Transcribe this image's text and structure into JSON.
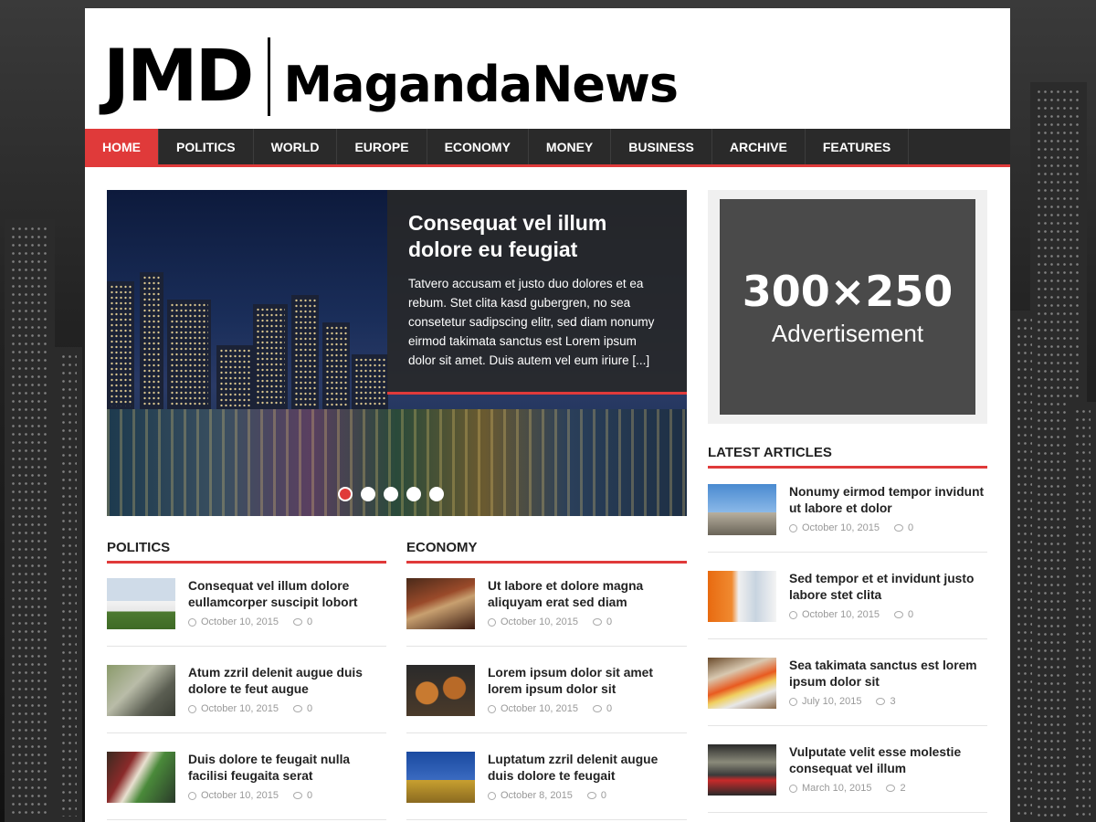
{
  "logo": {
    "left": "JMD",
    "right": "MagandaNews"
  },
  "nav": [
    "HOME",
    "POLITICS",
    "WORLD",
    "EUROPE",
    "ECONOMY",
    "MONEY",
    "BUSINESS",
    "ARCHIVE",
    "FEATURES"
  ],
  "slider": {
    "title": "Consequat vel illum dolore eu feugiat",
    "text": "Tatvero accusam et justo duo dolores et ea rebum. Stet clita kasd gubergren, no sea consetetur sadipscing elitr, sed diam nonumy eirmod takimata sanctus est Lorem ipsum dolor sit amet. Duis autem vel eum iriure [...]",
    "slide_count": 5,
    "active_slide": 1
  },
  "ad": {
    "size": "300×250",
    "label": "Advertisement"
  },
  "politics": {
    "heading": "POLITICS",
    "articles": [
      {
        "title": "Consequat vel illum dolore eullamcorper suscipit lobort",
        "date": "October 10, 2015",
        "comments": "0"
      },
      {
        "title": "Atum zzril delenit augue duis dolore te feut augue",
        "date": "October 10, 2015",
        "comments": "0"
      },
      {
        "title": "Duis dolore te feugait nulla facilisi feugaita serat",
        "date": "October 10, 2015",
        "comments": "0"
      }
    ]
  },
  "economy": {
    "heading": "ECONOMY",
    "articles": [
      {
        "title": "Ut labore et dolore magna aliquyam erat sed diam",
        "date": "October 10, 2015",
        "comments": "0"
      },
      {
        "title": "Lorem ipsum dolor sit amet lorem ipsum dolor sit",
        "date": "October 10, 2015",
        "comments": "0"
      },
      {
        "title": "Luptatum zzril delenit augue duis dolore te feugait",
        "date": "October 8, 2015",
        "comments": "0"
      }
    ]
  },
  "latest": {
    "heading": "LATEST ARTICLES",
    "articles": [
      {
        "title": "Nonumy eirmod tempor invidunt ut labore et dolor",
        "date": "October 10, 2015",
        "comments": "0"
      },
      {
        "title": "Sed tempor et et invidunt justo labore stet clita",
        "date": "October 10, 2015",
        "comments": "0"
      },
      {
        "title": "Sea takimata sanctus est lorem ipsum dolor sit",
        "date": "July 10, 2015",
        "comments": "3"
      },
      {
        "title": "Vulputate velit esse molestie consequat vel illum",
        "date": "March 10, 2015",
        "comments": "2"
      }
    ]
  },
  "colors": {
    "accent": "#e03a3a",
    "nav_bg": "#2a2a2a",
    "ad_bg": "#4a4a4a"
  }
}
